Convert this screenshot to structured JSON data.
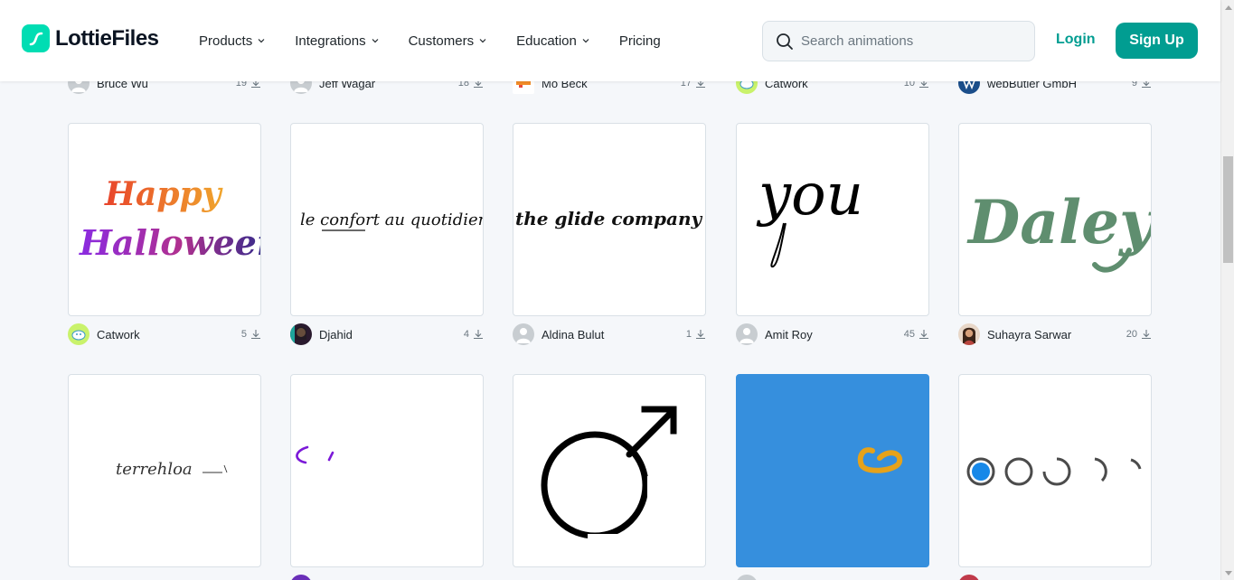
{
  "header": {
    "brand": "LottieFiles",
    "nav": [
      {
        "label": "Products",
        "dropdown": true
      },
      {
        "label": "Integrations",
        "dropdown": true
      },
      {
        "label": "Customers",
        "dropdown": true
      },
      {
        "label": "Education",
        "dropdown": true
      },
      {
        "label": "Pricing",
        "dropdown": false
      }
    ],
    "search_placeholder": "Search animations",
    "login": "Login",
    "signup": "Sign Up"
  },
  "colors": {
    "brand": "#019d91",
    "logo": "#00ddb3",
    "page_bg": "#f5f7fa"
  },
  "top_row": [
    {
      "author": "Bruce Wu",
      "downloads": "19"
    },
    {
      "author": "Jeff Wagar",
      "downloads": "18"
    },
    {
      "author": "Mo Beck",
      "downloads": "17"
    },
    {
      "author": "Catwork",
      "downloads": "10"
    },
    {
      "author": "webButler GmbH",
      "downloads": "9"
    }
  ],
  "row1": [
    {
      "author": "Catwork",
      "downloads": "5",
      "preview": "happy-halloween-lettering"
    },
    {
      "author": "Djahid",
      "downloads": "4",
      "preview": "le-confort-au-quotidien-lettering"
    },
    {
      "author": "Aldina Bulut",
      "downloads": "1",
      "preview": "the-glide-company-lettering"
    },
    {
      "author": "Amit Roy",
      "downloads": "45",
      "preview": "you-lettering"
    },
    {
      "author": "Suhayra Sarwar",
      "downloads": "20",
      "preview": "daley-lettering"
    }
  ],
  "row2": [
    {
      "preview": "signature-lettering"
    },
    {
      "preview": "purple-stroke"
    },
    {
      "preview": "male-symbol"
    },
    {
      "preview": "blue-card-yellow-stroke"
    },
    {
      "preview": "circle-loader"
    }
  ],
  "lettering": {
    "happy": "Happy",
    "halloween": "Halloween",
    "confort": "le confort au quotidien",
    "glide": "the glide company",
    "you": "you",
    "daley": "Daley",
    "signature": "terrehloa"
  }
}
